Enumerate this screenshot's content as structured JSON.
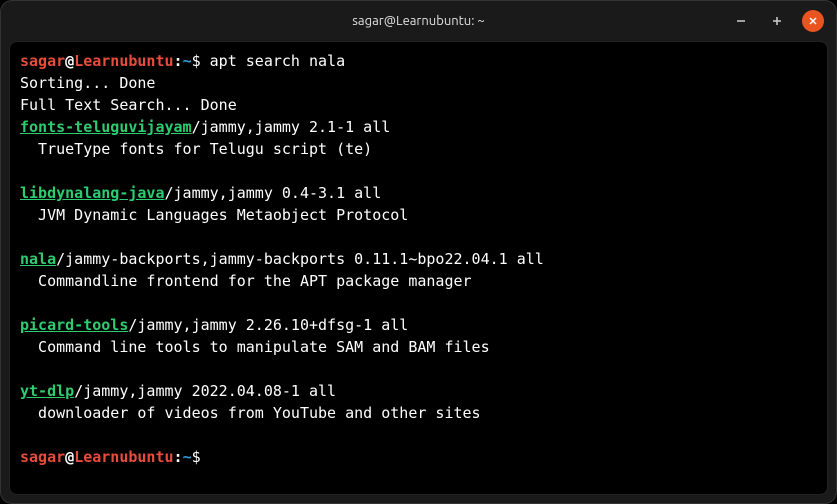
{
  "titlebar": {
    "title": "sagar@Learnubuntu: ~"
  },
  "prompt": {
    "user": "sagar",
    "at": "@",
    "host": "Learnubuntu",
    "colon": ":",
    "path": "~",
    "dollar": "$"
  },
  "command": " apt search nala",
  "output": {
    "sorting": "Sorting... Done",
    "fulltext": "Full Text Search... Done"
  },
  "packages": [
    {
      "name": "fonts-teluguvijayam",
      "info": "/jammy,jammy 2.1-1 all",
      "desc": "  TrueType fonts for Telugu script (te)"
    },
    {
      "name": "libdynalang-java",
      "info": "/jammy,jammy 0.4-3.1 all",
      "desc": "  JVM Dynamic Languages Metaobject Protocol"
    },
    {
      "name": "nala",
      "info": "/jammy-backports,jammy-backports 0.11.1~bpo22.04.1 all",
      "desc": "  Commandline frontend for the APT package manager"
    },
    {
      "name": "picard-tools",
      "info": "/jammy,jammy 2.26.10+dfsg-1 all",
      "desc": "  Command line tools to manipulate SAM and BAM files"
    },
    {
      "name": "yt-dlp",
      "info": "/jammy,jammy 2022.04.08-1 all",
      "desc": "  downloader of videos from YouTube and other sites"
    }
  ]
}
